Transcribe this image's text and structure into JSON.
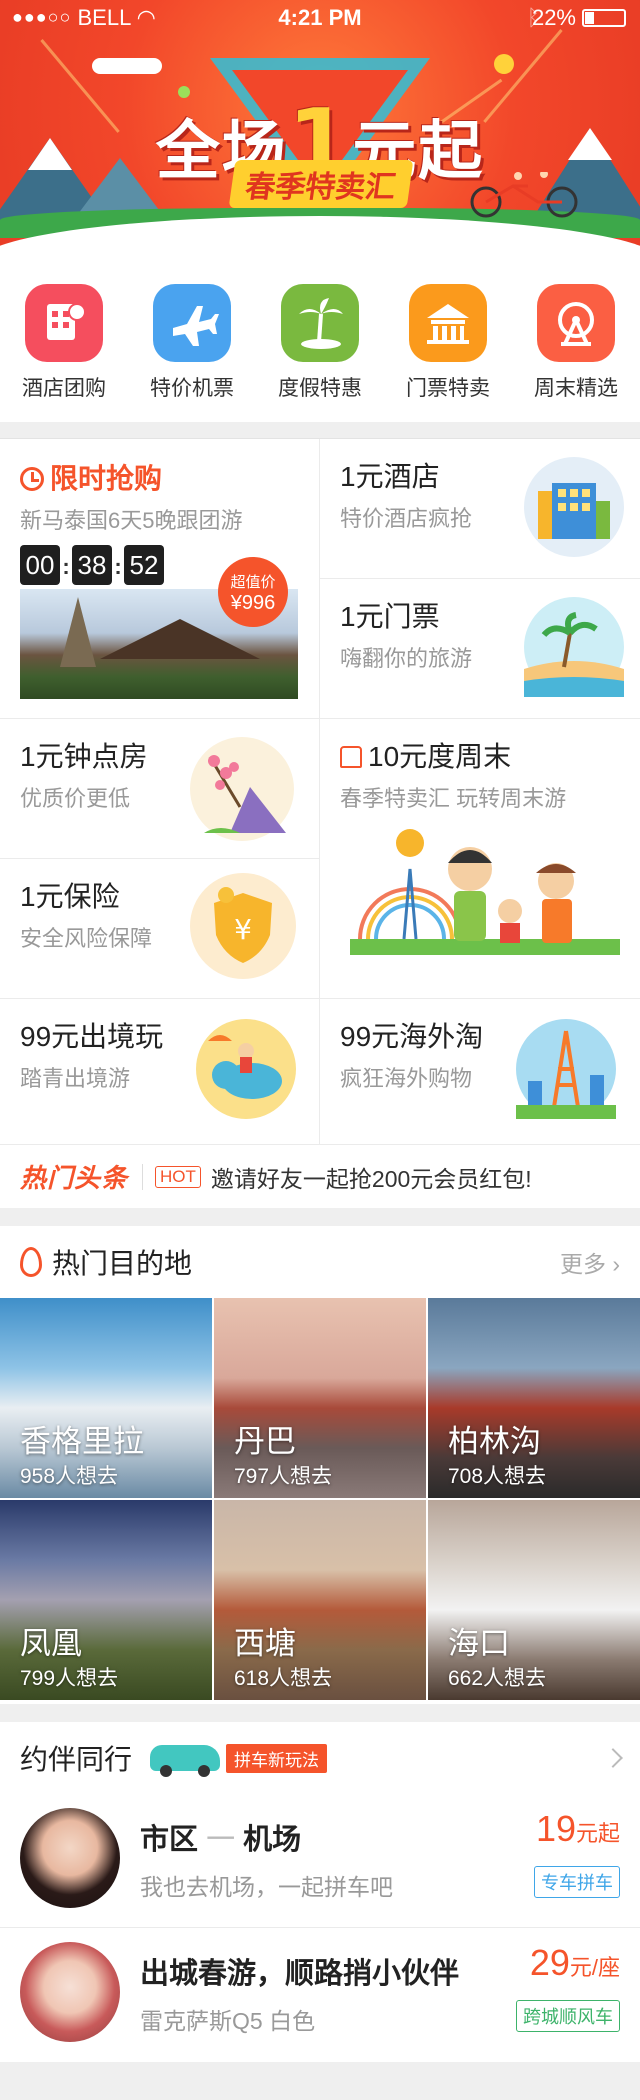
{
  "status_bar": {
    "signal": "●●●○○",
    "carrier": "BELL",
    "time": "4:21 PM",
    "battery": "22%"
  },
  "banner": {
    "title_a": "全场",
    "title_big": "1",
    "title_b": "元起",
    "subtitle": "春季特卖汇"
  },
  "nav": [
    {
      "label": "酒店团购",
      "icon": "hotel-icon",
      "color": "#f54e5e"
    },
    {
      "label": "特价机票",
      "icon": "plane-icon",
      "color": "#4aa3ef"
    },
    {
      "label": "度假特惠",
      "icon": "palm-icon",
      "color": "#7ab93f"
    },
    {
      "label": "门票特卖",
      "icon": "temple-icon",
      "color": "#fb9a1c"
    },
    {
      "label": "周末精选",
      "icon": "ferris-wheel-icon",
      "color": "#fb5f43"
    }
  ],
  "flash": {
    "title": "限时抢购",
    "desc": "新马泰国6天5晚跟团游",
    "hh": "00",
    "mm": "38",
    "ss": "52",
    "badge_label": "超值价",
    "badge_price": "¥996"
  },
  "hotel": {
    "title": "1元酒店",
    "desc": "特价酒店疯抢"
  },
  "ticket": {
    "title": "1元门票",
    "desc": "嗨翻你的旅游"
  },
  "hourly": {
    "title": "1元钟点房",
    "desc": "优质价更低"
  },
  "weekend": {
    "title": "10元度周末",
    "desc": "春季特卖汇  玩转周末游"
  },
  "insurance": {
    "title": "1元保险",
    "desc": "安全风险保障"
  },
  "outbound": {
    "title": "99元出境玩",
    "desc": "踏青出境游"
  },
  "shopping": {
    "title": "99元海外淘",
    "desc": "疯狂海外购物"
  },
  "headline": {
    "logo": "热门头条",
    "hot": "HOT",
    "text": "邀请好友一起抢200元会员红包!"
  },
  "destinations": {
    "title": "热门目的地",
    "more": "更多",
    "items": [
      {
        "name": "香格里拉",
        "count": "958人想去"
      },
      {
        "name": "丹巴",
        "count": "797人想去"
      },
      {
        "name": "柏林沟",
        "count": "708人想去"
      },
      {
        "name": "凤凰",
        "count": "799人想去"
      },
      {
        "name": "西塘",
        "count": "618人想去"
      },
      {
        "name": "海口",
        "count": "662人想去"
      }
    ]
  },
  "companions": {
    "title": "约伴同行",
    "tag": "拼车新玩法",
    "items": [
      {
        "from": "市区",
        "arrow": "一",
        "to": "机场",
        "desc": "我也去机场，一起拼车吧",
        "price": "19",
        "unit": "元起",
        "tag": "专车拼车",
        "tag_color": "#3fa6e8"
      },
      {
        "title": "出城春游，顺路捎小伙伴",
        "desc": "雷克萨斯Q5  白色",
        "price": "29",
        "unit": "元/座",
        "tag": "跨城顺风车",
        "tag_color": "#3db36a"
      }
    ]
  }
}
